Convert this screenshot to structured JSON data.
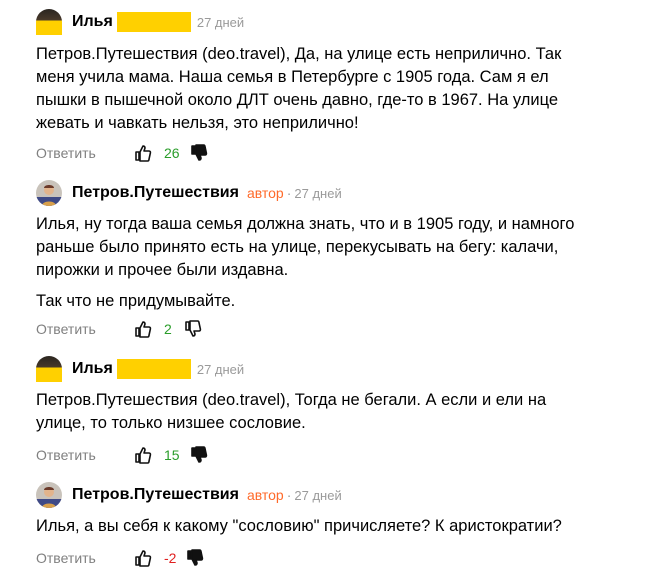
{
  "comments": [
    {
      "author": "Илья",
      "is_author": false,
      "date": "27 дней",
      "paragraphs": [
        "Петров.Путешествия (deo.travel), Да, на улице есть неприлично. Так меня учила мама. Наша семья в Петербурге с 1905 года. Сам я ел пышки в пышечной около ДЛТ очень давно, где-то в 1967. На улице жевать и чавкать нельзя, это неприлично!"
      ],
      "reply_label": "Ответить",
      "likes": "26",
      "likes_color": "#2a9d2a",
      "liked": true,
      "disliked": true
    },
    {
      "author": "Петров.Путешествия",
      "is_author": true,
      "author_badge": "автор",
      "date": "27 дней",
      "paragraphs": [
        "Илья, ну тогда ваша семья должна знать, что и в 1905 году, и намного раньше было принято есть на улице, перекусывать на бегу: калачи, пирожки и прочее были издавна.",
        "Так что не придумывайте."
      ],
      "reply_label": "Ответить",
      "likes": "2",
      "likes_color": "#2a9d2a",
      "liked": false,
      "disliked": false
    },
    {
      "author": "Илья",
      "is_author": false,
      "date": "27 дней",
      "paragraphs": [
        "Петров.Путешествия (deo.travel), Тогда не бегали. А если и ели на улице, то только низшее сословие."
      ],
      "reply_label": "Ответить",
      "likes": "15",
      "likes_color": "#2a9d2a",
      "liked": true,
      "disliked": true
    },
    {
      "author": "Петров.Путешествия",
      "is_author": true,
      "author_badge": "автор",
      "date": "27 дней",
      "paragraphs": [
        "Илья, а вы себя к какому \"сословию\" причисляете? К аристократии?"
      ],
      "reply_label": "Ответить",
      "likes": "-2",
      "likes_color": "#e02020",
      "liked": false,
      "disliked": true
    }
  ],
  "icons": {
    "like": "thumbs-up-icon",
    "dislike": "thumbs-down-icon"
  }
}
